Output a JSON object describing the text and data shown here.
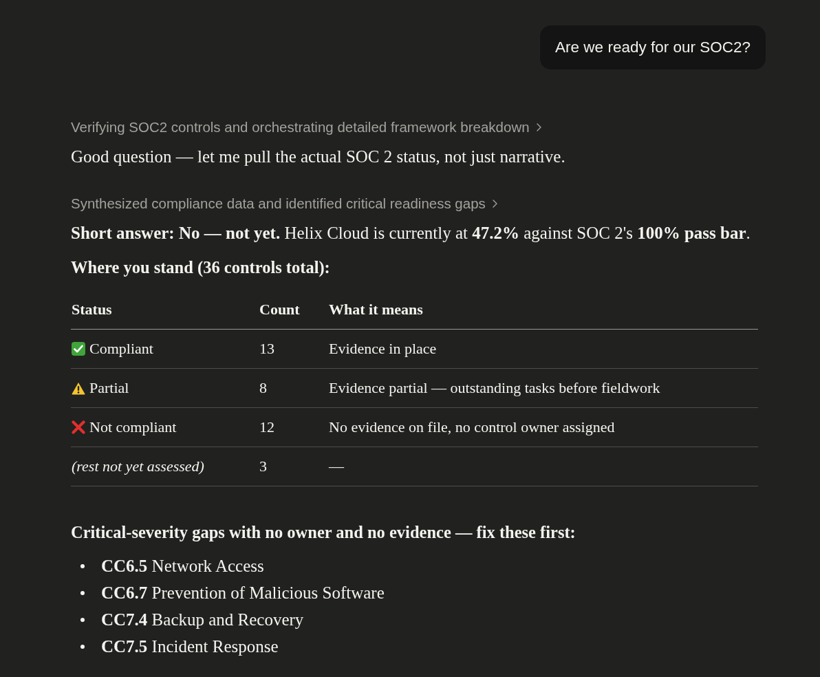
{
  "user_message": {
    "text": "Are we ready for our SOC2?"
  },
  "response": [
    {
      "kind": "thinking",
      "text": "Verifying SOC2 controls and orchestrating detailed framework breakdown",
      "expanded": false
    },
    {
      "kind": "paragraph",
      "text": "Good question — let me pull the actual SOC 2 status, not just narrative."
    },
    {
      "kind": "thinking",
      "text": "Synthesized compliance data and identified critical readiness gaps",
      "expanded": false
    },
    {
      "kind": "paragraph",
      "text": "**Short answer: No — not yet.** Helix Cloud is currently at **47.2%** against SOC 2's **100% pass bar**."
    },
    {
      "kind": "heading",
      "text": "Where you stand (36 controls total):"
    },
    {
      "kind": "table",
      "columns": [
        "Status",
        "Count",
        "What it means"
      ],
      "rows": [
        {
          "kind": "compliant",
          "label": "Compliant",
          "count": "13",
          "meaning": "Evidence in place"
        },
        {
          "kind": "partial",
          "label": "Partial",
          "count": "8",
          "meaning": "Evidence partial — outstanding tasks before fieldwork"
        },
        {
          "kind": "failing",
          "label": "Not compliant",
          "count": "12",
          "meaning": "No evidence on file, no control owner assigned"
        },
        {
          "kind": "unassessed",
          "label": "(rest not yet assessed)",
          "count": "3",
          "meaning": "—"
        }
      ]
    },
    {
      "kind": "heading",
      "text": "Critical-severity gaps with no owner and no evidence — fix these first:"
    },
    {
      "kind": "list",
      "items": [
        "**CC6.5** Network Access",
        "**CC6.7** Prevention of Malicious Software",
        "**CC7.4** Backup and Recovery",
        "**CC7.5** Incident Response"
      ]
    }
  ]
}
